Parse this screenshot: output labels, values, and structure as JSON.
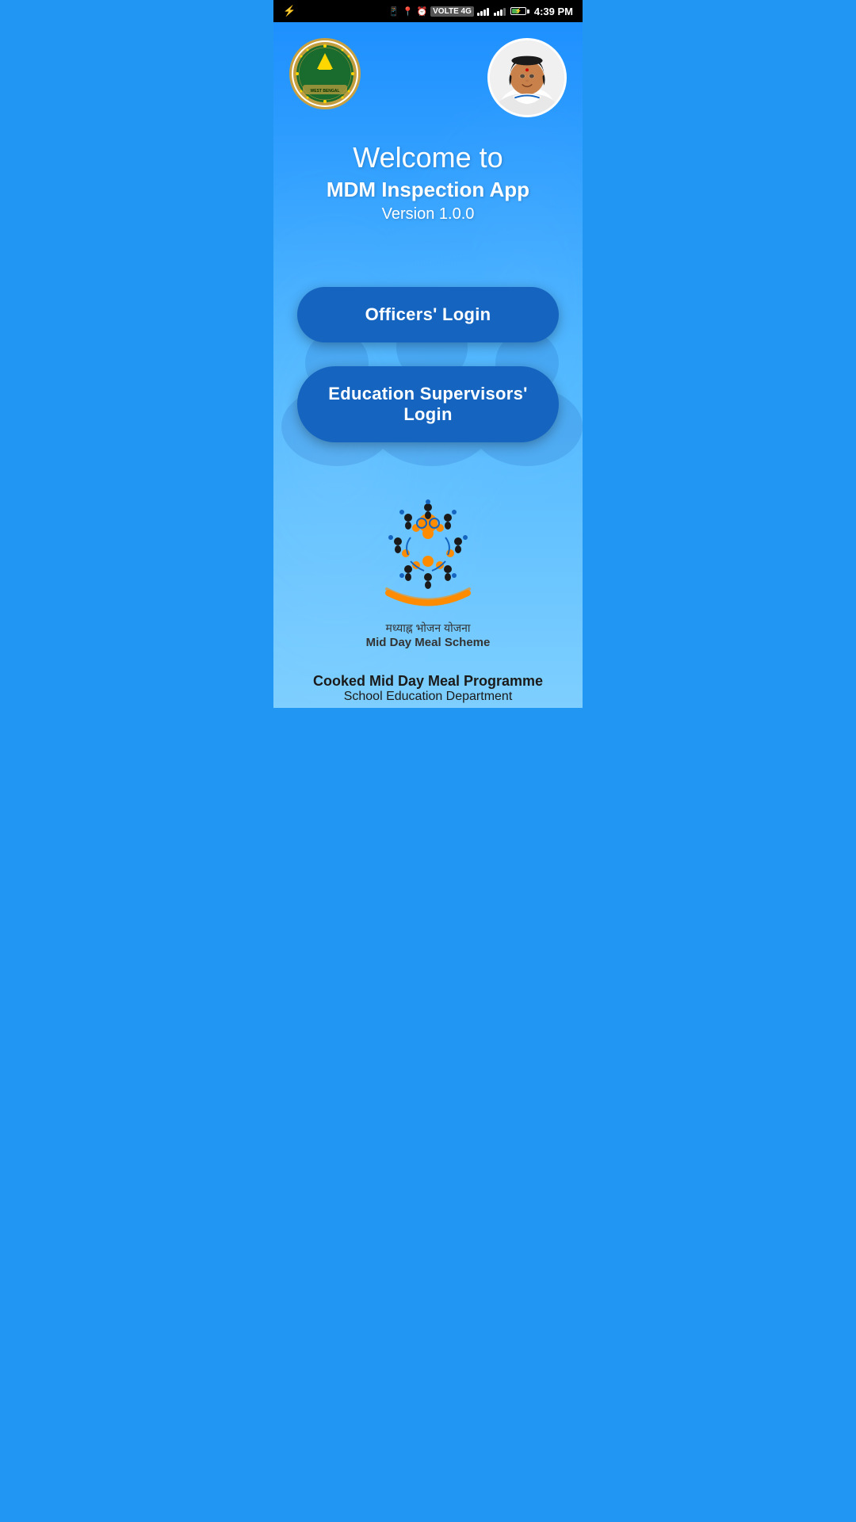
{
  "statusBar": {
    "time": "4:39 PM",
    "usb": "⚡",
    "carrier": "VOLTE 4G"
  },
  "header": {
    "emblem": {
      "alt": "Govt. of West Bengal Emblem"
    },
    "avatar": {
      "alt": "Government Official Photo"
    }
  },
  "welcome": {
    "welcome_line": "Welcome to",
    "app_name": "MDM Inspection App",
    "version": "Version 1.0.0"
  },
  "buttons": {
    "officers_login": "Officers' Login",
    "supervisors_login": "Education Supervisors' Login"
  },
  "mdm_scheme": {
    "hindi_text": "मध्याह्न भोजन योजना",
    "english_text": "Mid Day Meal Scheme"
  },
  "footer": {
    "line1": "Cooked Mid Day Meal Programme",
    "line2": "School Education Department"
  }
}
